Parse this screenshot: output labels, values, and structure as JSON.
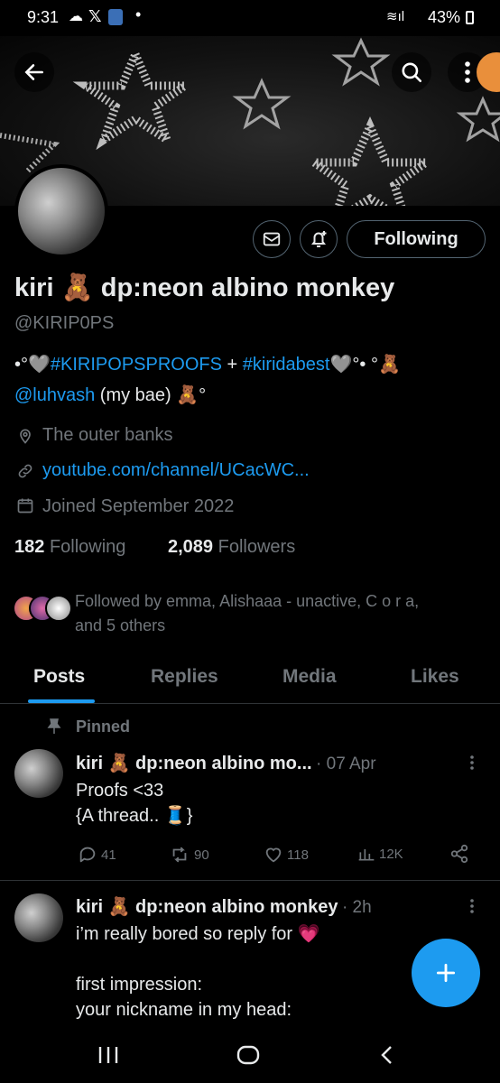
{
  "statusbar": {
    "time": "9:31",
    "battery": "43%"
  },
  "profile": {
    "display_name": "kiri 🧸 dp:neon albino monkey",
    "handle": "@KIRIP0PS",
    "bio_line1_pre": "•°🩶",
    "bio_tag1": "#KIRIPOPSPROOFS",
    "bio_plus": " + ",
    "bio_tag2": "#kiridabest",
    "bio_line1_post": "🩶°• °🧸",
    "bio_mention": "@luhvash",
    "bio_line2_post": " (my bae) 🧸°",
    "location": "The outer banks",
    "website": "youtube.com/channel/UCacWC...",
    "joined": "Joined September 2022",
    "following_count": "182",
    "following_label": "Following",
    "followers_count": "2,089",
    "followers_label": "Followers",
    "followed_by_line1": "Followed by emma, Alishaaa - unactive, C o r a,",
    "followed_by_line2": "and 5 others",
    "follow_button": "Following"
  },
  "tabs": [
    "Posts",
    "Replies",
    "Media",
    "Likes"
  ],
  "pinned_label": "Pinned",
  "tweets": [
    {
      "name": "kiri 🧸 dp:neon albino mo...",
      "meta": "· 07 Apr",
      "line1": "Proofs <33",
      "line2": "{A thread.. 🧵}",
      "replies": "41",
      "retweets": "90",
      "likes": "118",
      "views": "12K"
    },
    {
      "name": "kiri 🧸 dp:neon albino monkey",
      "meta": "· 2h",
      "line1": "i’m really bored so reply for 💗",
      "line2": "first impression:",
      "line3": "your nickname in my head:"
    }
  ],
  "colors": {
    "accent": "#1d9bf0",
    "muted": "#71767b",
    "background": "#000000"
  }
}
